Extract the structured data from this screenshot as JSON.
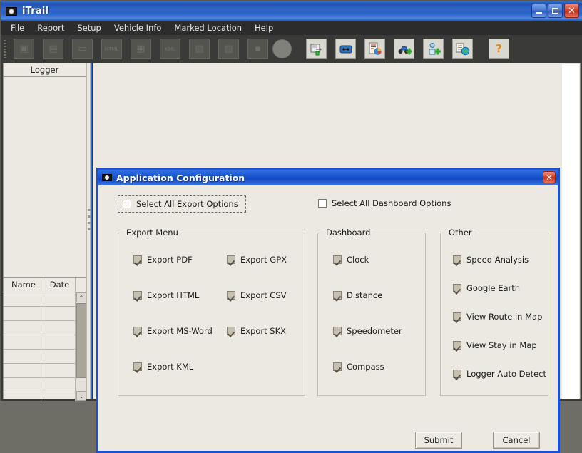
{
  "window": {
    "title": "iTrail",
    "icon": "camera-icon",
    "controls": {
      "minimize": "–",
      "maximize": "□",
      "close": "✕"
    }
  },
  "menubar": {
    "items": [
      {
        "label": "File"
      },
      {
        "label": "Report"
      },
      {
        "label": "Setup"
      },
      {
        "label": "Vehicle Info"
      },
      {
        "label": "Marked Location"
      },
      {
        "label": "Help"
      }
    ]
  },
  "toolbar": {
    "buttons": [
      {
        "name": "new-trip-icon",
        "glyph": "▣",
        "state": "disabled"
      },
      {
        "name": "save-device-icon",
        "glyph": "▤",
        "state": "disabled"
      },
      {
        "name": "open-folder-icon",
        "glyph": "▭",
        "state": "disabled"
      },
      {
        "name": "export-html-icon",
        "glyph": "◇",
        "label": "HTML",
        "state": "disabled"
      },
      {
        "name": "export-msword-icon",
        "glyph": "▦",
        "state": "disabled"
      },
      {
        "name": "export-kml-icon",
        "glyph": "▩",
        "label": "KML",
        "state": "disabled"
      },
      {
        "name": "export-excel-icon",
        "glyph": "▧",
        "state": "disabled"
      },
      {
        "name": "export-pdf-icon",
        "glyph": "▨",
        "state": "disabled"
      },
      {
        "name": "export-copy-icon",
        "glyph": "▪",
        "state": "disabled"
      },
      {
        "name": "record-circle-icon",
        "glyph": "●",
        "state": "disabled"
      },
      {
        "name": "configure-logger-icon",
        "glyph": "⚙",
        "state": "enabled"
      },
      {
        "name": "logger-device-icon",
        "glyph": "▬",
        "state": "enabled"
      },
      {
        "name": "report-chart-icon",
        "glyph": "◕",
        "state": "enabled"
      },
      {
        "name": "add-vehicle-icon",
        "glyph": "✚",
        "state": "enabled"
      },
      {
        "name": "add-driver-icon",
        "glyph": "✚",
        "state": "enabled"
      },
      {
        "name": "marked-location-icon",
        "glyph": "◍",
        "state": "enabled"
      },
      {
        "name": "help-icon",
        "glyph": "?",
        "state": "enabled"
      }
    ]
  },
  "left_panel": {
    "logger_header": "Logger",
    "table": {
      "columns": [
        "Name",
        "Date"
      ],
      "rows": [
        [
          "",
          ""
        ],
        [
          "",
          ""
        ],
        [
          "",
          ""
        ],
        [
          "",
          ""
        ],
        [
          "",
          ""
        ],
        [
          "",
          ""
        ],
        [
          "",
          ""
        ],
        [
          "",
          ""
        ]
      ]
    },
    "scrollbar": {
      "up": "⌃",
      "down": "⌄"
    }
  },
  "dialog": {
    "title": "Application Configuration",
    "icon": "camera-icon",
    "close_glyph": "✕",
    "select_all_export": {
      "label": "Select All Export Options",
      "checked": false
    },
    "select_all_dashboard": {
      "label": "Select All Dashboard Options",
      "checked": false
    },
    "groups": [
      {
        "name": "export-menu",
        "title": "Export Menu",
        "columns": [
          [
            {
              "label": "Export PDF",
              "checked": true
            },
            {
              "label": "Export HTML",
              "checked": true
            },
            {
              "label": "Export MS-Word",
              "checked": true
            },
            {
              "label": "Export KML",
              "checked": true
            }
          ],
          [
            {
              "label": "Export GPX",
              "checked": true
            },
            {
              "label": "Export CSV",
              "checked": true
            },
            {
              "label": "Export SKX",
              "checked": true
            }
          ]
        ]
      },
      {
        "name": "dashboard",
        "title": "Dashboard",
        "columns": [
          [
            {
              "label": "Clock",
              "checked": true
            },
            {
              "label": "Distance",
              "checked": true
            },
            {
              "label": "Speedometer",
              "checked": true
            },
            {
              "label": "Compass",
              "checked": true
            }
          ]
        ]
      },
      {
        "name": "other",
        "title": "Other",
        "columns": [
          [
            {
              "label": "Speed Analysis",
              "checked": true
            },
            {
              "label": "Google Earth",
              "checked": true
            },
            {
              "label": "View Route in Map",
              "checked": true
            },
            {
              "label": "View Stay in Map",
              "checked": true
            },
            {
              "label": "Logger Auto Detect",
              "checked": true
            }
          ]
        ]
      }
    ],
    "submit_label": "Submit",
    "cancel_label": "Cancel"
  },
  "colors": {
    "title_blue": "#1a53cc",
    "dialog_border": "#1b4fd8",
    "face": "#ece9e2",
    "toolbar_dark": "#3a3a38",
    "menu_dark": "#2c2c2c",
    "close_red": "#dc4228"
  }
}
